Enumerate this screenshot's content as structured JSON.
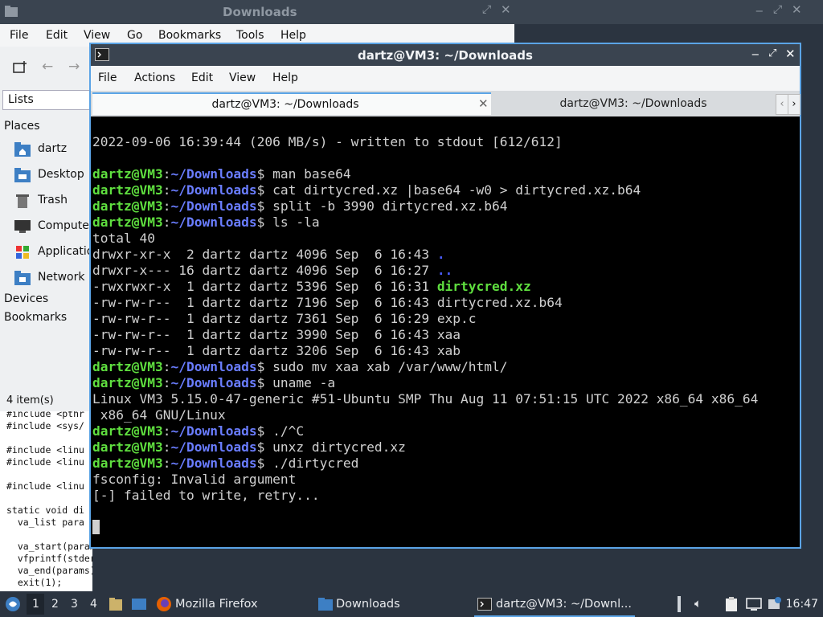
{
  "file_manager": {
    "title": "Downloads",
    "menu": [
      "File",
      "Edit",
      "View",
      "Go",
      "Bookmarks",
      "Tools",
      "Help"
    ],
    "lists_label": "Lists",
    "places_heading": "Places",
    "places": [
      {
        "label": "dartz",
        "icon": "home-folder-icon"
      },
      {
        "label": "Desktop",
        "icon": "desktop-folder-icon"
      },
      {
        "label": "Trash",
        "icon": "trash-icon"
      },
      {
        "label": "Compute",
        "icon": "computer-icon"
      },
      {
        "label": "Applicatio",
        "icon": "applications-icon"
      },
      {
        "label": "Network",
        "icon": "network-icon"
      }
    ],
    "devices_heading": "Devices",
    "bookmarks_heading": "Bookmarks",
    "status": "4 item(s)"
  },
  "background_code": [
    "#include <pthr",
    "#include <sys/",
    "",
    "#include <linu",
    "#include <linu",
    "",
    "#include <linu",
    "",
    "static void di",
    "  va_list para",
    "",
    "  va_start(params, fmt);",
    "  vfprintf(stderr, fmt, params);",
    "  va_end(params);",
    "  exit(1);"
  ],
  "terminal": {
    "title": "dartz@VM3: ~/Downloads",
    "menu": [
      "File",
      "Actions",
      "Edit",
      "View",
      "Help"
    ],
    "tabs": [
      "dartz@VM3: ~/Downloads",
      "dartz@VM3: ~/Downloads"
    ],
    "prompt_user": "dartz@VM3",
    "prompt_path": "~/Downloads",
    "prompt_sep": ":",
    "prompt_end": "$",
    "lines": [
      {
        "type": "out",
        "text": "2022-09-06 16:39:44 (206 MB/s) - written to stdout [612/612]"
      },
      {
        "type": "out",
        "text": ""
      },
      {
        "type": "cmd",
        "text": "man base64"
      },
      {
        "type": "cmd",
        "text": "cat dirtycred.xz |base64 -w0 > dirtycred.xz.b64"
      },
      {
        "type": "cmd",
        "text": "split -b 3990 dirtycred.xz.b64"
      },
      {
        "type": "cmd",
        "text": "ls -la"
      },
      {
        "type": "out",
        "text": "total 40"
      },
      {
        "type": "ls",
        "text": "drwxr-xr-x  2 dartz dartz 4096 Sep  6 16:43 ",
        "name": ".",
        "kind": "dir"
      },
      {
        "type": "ls",
        "text": "drwxr-x--- 16 dartz dartz 4096 Sep  6 16:27 ",
        "name": "..",
        "kind": "dir"
      },
      {
        "type": "ls",
        "text": "-rwxrwxr-x  1 dartz dartz 5396 Sep  6 16:31 ",
        "name": "dirtycred.xz",
        "kind": "exe"
      },
      {
        "type": "ls",
        "text": "-rw-rw-r--  1 dartz dartz 7196 Sep  6 16:43 ",
        "name": "dirtycred.xz.b64",
        "kind": "file"
      },
      {
        "type": "ls",
        "text": "-rw-rw-r--  1 dartz dartz 7361 Sep  6 16:29 ",
        "name": "exp.c",
        "kind": "file"
      },
      {
        "type": "ls",
        "text": "-rw-rw-r--  1 dartz dartz 3990 Sep  6 16:43 ",
        "name": "xaa",
        "kind": "file"
      },
      {
        "type": "ls",
        "text": "-rw-rw-r--  1 dartz dartz 3206 Sep  6 16:43 ",
        "name": "xab",
        "kind": "file"
      },
      {
        "type": "cmd",
        "text": "sudo mv xaa xab /var/www/html/"
      },
      {
        "type": "cmd",
        "text": "uname -a"
      },
      {
        "type": "out",
        "text": "Linux VM3 5.15.0-47-generic #51-Ubuntu SMP Thu Aug 11 07:51:15 UTC 2022 x86_64 x86_64"
      },
      {
        "type": "out",
        "text": " x86_64 GNU/Linux"
      },
      {
        "type": "cmd",
        "text": "./^C"
      },
      {
        "type": "cmd",
        "text": "unxz dirtycred.xz"
      },
      {
        "type": "cmd",
        "text": "./dirtycred"
      },
      {
        "type": "out",
        "text": "fsconfig: Invalid argument"
      },
      {
        "type": "out",
        "text": "[-] failed to write, retry..."
      }
    ]
  },
  "taskbar": {
    "workspaces": [
      "1",
      "2",
      "3",
      "4"
    ],
    "tasks": [
      {
        "label": "Mozilla Firefox",
        "icon": "firefox-icon"
      },
      {
        "label": "Downloads",
        "icon": "folder-icon"
      },
      {
        "label": "dartz@VM3: ~/Downl...",
        "icon": "terminal-icon"
      }
    ],
    "clock": "16:47"
  },
  "colors": {
    "accent": "#5ba4e6",
    "prompt_user": "#5fdf3f",
    "prompt_path": "#6a7dff",
    "panel": "#2b3440"
  }
}
